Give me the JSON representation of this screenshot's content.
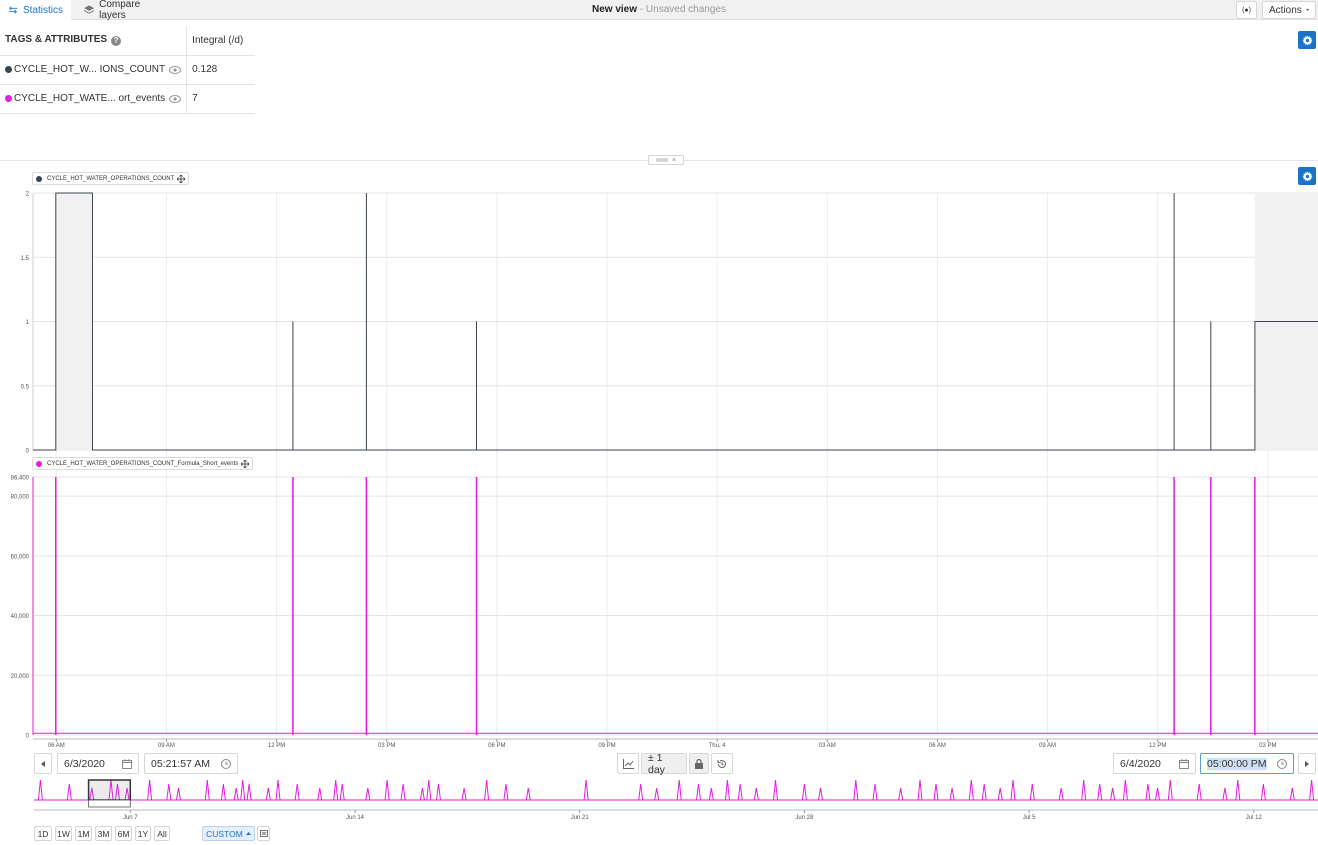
{
  "tabs": [
    {
      "label": "Statistics",
      "active": true
    },
    {
      "label": "Compare layers",
      "active": false
    }
  ],
  "view": {
    "title": "New view",
    "separator": " - ",
    "status": "Unsaved changes"
  },
  "header_buttons": {
    "live_label": "(●)",
    "actions_label": "Actions"
  },
  "stats_table": {
    "headers": {
      "tags": "TAGS & ATTRIBUTES",
      "integral": "Integral (/d)"
    },
    "rows": [
      {
        "tag": "CYCLE_HOT_W... IONS_COUNT",
        "value": "0.128",
        "color": "#3b4550"
      },
      {
        "tag": "CYCLE_HOT_WATE... ort_events",
        "value": "7",
        "color": "#e619e6"
      }
    ]
  },
  "colors": {
    "accent": "#1a73c8",
    "series1": "#3b4550",
    "series2": "#e619e6"
  },
  "chart_data": [
    {
      "type": "line",
      "series": [
        {
          "name": "CYCLE_HOT_WATER_OPERATIONS_COUNT",
          "color": "#3b4550"
        }
      ],
      "ylim": [
        0,
        2
      ],
      "yticks": [
        "0",
        "0.5",
        "1",
        "1.5",
        "2"
      ],
      "x_hours": [
        0,
        0.62,
        0.62,
        1.62,
        1.62,
        7.08,
        7.08,
        7.08,
        9.08,
        9.08,
        9.08,
        12.08,
        12.08,
        12.08,
        31.08,
        31.08,
        31.08,
        32.08,
        32.08,
        32.08,
        33.28,
        33.28,
        35.0
      ],
      "y": [
        0,
        0,
        2,
        2,
        0,
        0,
        1,
        0,
        0,
        2,
        0,
        0,
        1,
        0,
        0,
        2,
        0,
        0,
        1,
        0,
        0,
        1,
        1
      ],
      "shaded_hours": [
        [
          0.62,
          1.62
        ],
        [
          33.28,
          35.0
        ]
      ]
    },
    {
      "type": "line",
      "series": [
        {
          "name": "CYCLE_HOT_WATER_OPERATIONS_COUNT_Formula_Short_events",
          "color": "#e619e6"
        }
      ],
      "ylim": [
        0,
        86400
      ],
      "yticks": [
        "0",
        "20,000",
        "40,000",
        "60,000",
        "80,000",
        "86,400"
      ],
      "spike_hours": [
        0.62,
        7.08,
        9.08,
        12.08,
        31.08,
        32.08,
        33.28
      ],
      "spike_value": 86400,
      "baseline": 600
    }
  ],
  "x_axis": {
    "start": "6/3/2020 05:21:57 AM",
    "end": "6/4/2020 05:00:00 PM",
    "ticks": [
      {
        "label": "06 AM",
        "hours": 0.634
      },
      {
        "label": "09 AM",
        "hours": 3.634
      },
      {
        "label": "12 PM",
        "hours": 6.634
      },
      {
        "label": "03 PM",
        "hours": 9.634
      },
      {
        "label": "06 PM",
        "hours": 12.634
      },
      {
        "label": "09 PM",
        "hours": 15.634
      },
      {
        "label": "Thu, 4",
        "hours": 18.634
      },
      {
        "label": "03 AM",
        "hours": 21.634
      },
      {
        "label": "06 AM",
        "hours": 24.634
      },
      {
        "label": "09 AM",
        "hours": 27.634
      },
      {
        "label": "12 PM",
        "hours": 30.634
      },
      {
        "label": "03 PM",
        "hours": 33.634
      }
    ]
  },
  "time_controls": {
    "start_date": "6/3/2020",
    "start_time": "05:21:57 AM",
    "end_date": "6/4/2020",
    "end_time": "05:00:00 PM",
    "zoom_label": "± 1 day"
  },
  "navigator": {
    "ticks": [
      {
        "label": "Jun 7",
        "day": 3
      },
      {
        "label": "Jun 14",
        "day": 10
      },
      {
        "label": "Jun 21",
        "day": 17
      },
      {
        "label": "Jun 28",
        "day": 24
      },
      {
        "label": "Jul 5",
        "day": 31
      },
      {
        "label": "Jul 12",
        "day": 38
      }
    ],
    "spike_days": [
      0.2,
      1.1,
      1.8,
      2.4,
      2.6,
      2.9,
      3.6,
      4.2,
      4.5,
      5.4,
      5.9,
      6.3,
      6.5,
      6.7,
      7.3,
      7.6,
      8.2,
      8.9,
      9.4,
      9.6,
      10.4,
      11.0,
      11.5,
      12.1,
      12.3,
      12.6,
      13.4,
      14.1,
      14.7,
      15.4,
      17.2,
      18.9,
      19.4,
      20.1,
      20.7,
      21.1,
      21.6,
      22.0,
      22.5,
      23.1,
      24.0,
      24.5,
      25.6,
      26.2,
      27.0,
      27.6,
      28.1,
      28.6,
      29.2,
      29.6,
      30.1,
      30.5,
      31.1,
      32.0,
      32.7,
      33.2,
      33.6,
      34.0,
      34.7,
      35.0,
      35.4,
      36.3,
      37.1,
      37.5,
      38.3,
      39.2,
      39.8
    ],
    "window_days": [
      1.7,
      3.0
    ]
  },
  "range_buttons": [
    "1D",
    "1W",
    "1M",
    "3M",
    "6M",
    "1Y",
    "All"
  ],
  "custom_label": "CUSTOM"
}
